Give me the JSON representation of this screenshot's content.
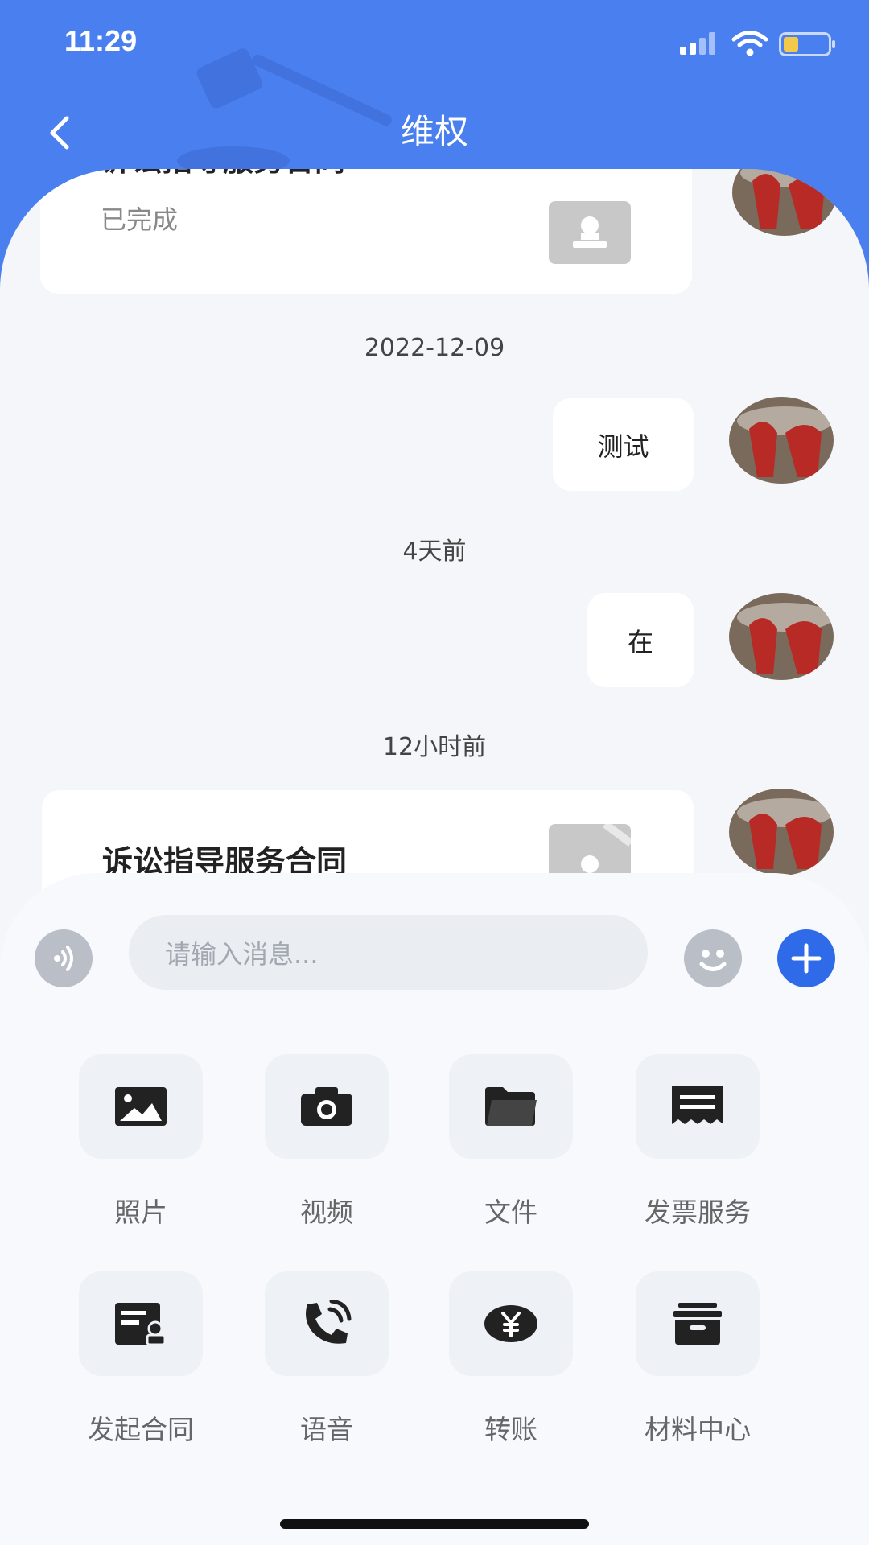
{
  "status_bar": {
    "time": "11:29"
  },
  "header": {
    "title": "维权"
  },
  "chat": {
    "card_top": {
      "title": "诉讼指导服务合同",
      "status": "已完成"
    },
    "timestamps": [
      "2022-12-09",
      "4天前",
      "12小时前"
    ],
    "messages": [
      "测试",
      "在"
    ],
    "card_bottom": {
      "title": "诉讼指导服务合同"
    }
  },
  "input": {
    "placeholder": "请输入消息..."
  },
  "tools": [
    {
      "label": "照片",
      "icon": "photo-icon"
    },
    {
      "label": "视频",
      "icon": "camera-icon"
    },
    {
      "label": "文件",
      "icon": "folder-icon"
    },
    {
      "label": "发票服务",
      "icon": "invoice-icon"
    },
    {
      "label": "发起合同",
      "icon": "contract-icon"
    },
    {
      "label": "语音",
      "icon": "phone-icon"
    },
    {
      "label": "转账",
      "icon": "yuan-icon"
    },
    {
      "label": "材料中心",
      "icon": "archive-icon"
    }
  ],
  "colors": {
    "header": "#4a7ff0",
    "accent": "#2f6be8"
  }
}
